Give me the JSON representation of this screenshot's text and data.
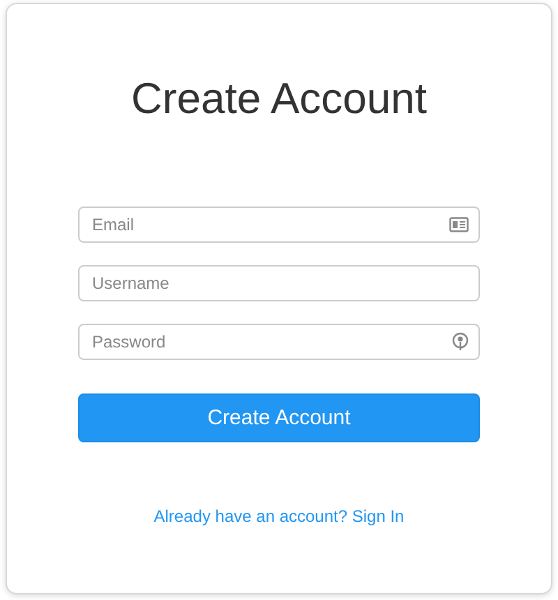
{
  "title": "Create Account",
  "fields": [
    {
      "placeholder": "Email",
      "kind": "email"
    },
    {
      "placeholder": "Username",
      "kind": "text"
    },
    {
      "placeholder": "Password",
      "kind": "password"
    }
  ],
  "submit": "Create Account",
  "signin_link": "Already have an account? Sign In"
}
